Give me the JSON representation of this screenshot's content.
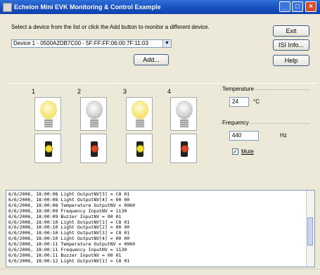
{
  "window": {
    "title": "Echelon Mini EVK Monitoring & Control Example"
  },
  "instructions": "Select a device from the list or click the Add button to monitor a different device.",
  "device_select": {
    "value": "Device 1 - 0500A2DB7C00 - 5F:FF:FF:06:00:7F:11:03"
  },
  "buttons": {
    "exit": "Exit",
    "isi_info": "ISI Info...",
    "help": "Help",
    "add": "Add..."
  },
  "devices": [
    {
      "number": "1",
      "bulb_state": "on",
      "switch_state": "yellow"
    },
    {
      "number": "2",
      "bulb_state": "off",
      "switch_state": "red"
    },
    {
      "number": "3",
      "bulb_state": "on",
      "switch_state": "yellow"
    },
    {
      "number": "4",
      "bulb_state": "off",
      "switch_state": "red"
    }
  ],
  "temperature": {
    "label": "Temperature",
    "value": "24",
    "unit": "°C"
  },
  "frequency": {
    "label": "Frequency",
    "value": "440",
    "unit": "Hz"
  },
  "mute": {
    "label": "Mute",
    "checked": true,
    "mark": "✓"
  },
  "log": [
    "6/6/2006, 18:00:08 Light OutputNV[3] = C8 01",
    "6/6/2006, 18:00:08 Light OutputNV[4] = 00 00",
    "6/6/2006, 18:00:08 Temperature OutputNV = 0960",
    "6/6/2006, 18:00:09 Frequency InputNV = 1130",
    "6/6/2006, 18:00:09 Buzzer InputNV = 00 01",
    "6/6/2006, 18:00:10 Light OutputNV[1] = C8 01",
    "6/6/2006, 18:00:10 Light OutputNV[2] = 00 00",
    "6/6/2006, 18:00:10 Light OutputNV[3] = C8 01",
    "6/6/2006, 18:00:10 Light OutputNV[4] = 00 00",
    "6/6/2006, 18:00:11 Temperature OutputNV = 0960",
    "6/6/2006, 18:00:11 Frequency InputNV = 1130",
    "6/6/2006, 18:00:11 Buzzer InputNV = 00 01",
    "6/6/2006, 18:00:12 Light OutputNV[1] = C8 01"
  ],
  "colors": {
    "titlebar": "#1650c0",
    "bulb_on": "#f7e98a",
    "bulb_off": "#d6d6d6"
  }
}
